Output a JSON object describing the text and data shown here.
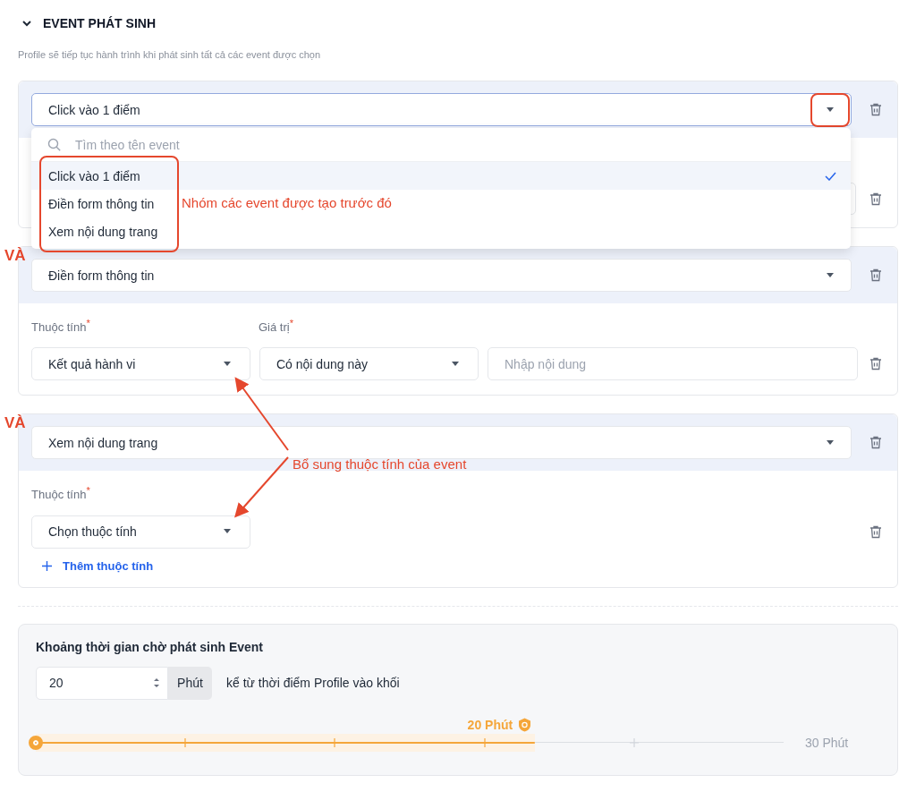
{
  "section": {
    "title": "EVENT PHÁT SINH",
    "expanded": true,
    "description": "Profile sẽ tiếp tục hành trình khi phát sinh tất cả các event được chọn"
  },
  "events": [
    {
      "name": "Click vào 1 điểm",
      "open": true,
      "covered_row": true,
      "dropdown": {
        "placeholder": "Tìm theo tên event",
        "options": [
          {
            "label": "Click vào 1 điểm",
            "selected": true
          },
          {
            "label": "Điền form thông tin",
            "selected": false
          },
          {
            "label": "Xem nội dung trang",
            "selected": false
          }
        ]
      }
    },
    {
      "name": "Điền form thông tin",
      "connector": "VÀ",
      "open": false,
      "covered_row": false,
      "labels": [
        {
          "text": "Thuộc tính",
          "mark": "*"
        },
        {
          "text": "Giá trị",
          "mark": "*"
        }
      ],
      "fields": [
        {
          "kind": "select",
          "value": "Kết quả hành vi"
        },
        {
          "kind": "select",
          "value": "Có nội dung này"
        },
        {
          "kind": "input",
          "placeholder": "Nhập nội dung"
        }
      ]
    },
    {
      "name": "Xem nội dung trang",
      "connector": "VÀ",
      "open": false,
      "covered_row": false,
      "labels": [
        {
          "text": "Thuộc tính",
          "mark": "*"
        }
      ],
      "fields": [
        {
          "kind": "select",
          "placeholder": "Chọn thuộc tính"
        }
      ],
      "add_link": "Thêm thuộc tính"
    }
  ],
  "wait": {
    "title": "Khoảng thời gian chờ phát sinh Event",
    "value": "20",
    "unit": "Phút",
    "suffix": "kể từ thời điểm Profile vào khối",
    "level": 0.667,
    "value_label": "20 Phút",
    "max_label": "30 Phút"
  },
  "annotations": {
    "caret_highlight": true,
    "options_highlight": true,
    "options_note": "Nhóm các event được tạo trước đó",
    "attribute_note": "Bổ sung thuộc tính của event"
  }
}
